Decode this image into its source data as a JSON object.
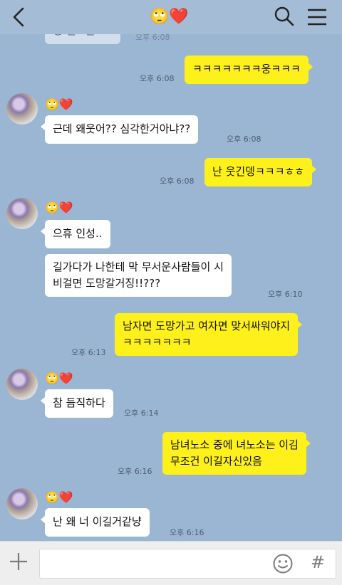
{
  "header": {
    "title": "🙄❤️"
  },
  "messages": [
    {
      "id": 0,
      "from": "other",
      "text": "형 헨드폰???",
      "time": "오후 6:08"
    },
    {
      "id": 1,
      "from": "me",
      "text": "ㅋㅋㅋㅋㅋㅋㅋ웅ㅋㅋㅋ",
      "time": "오후 6:08"
    },
    {
      "id": 2,
      "from": "other",
      "sender": "🙄❤️",
      "text": "근데 왜웃어?? 심각한거아냐??",
      "time": "오후 6:08"
    },
    {
      "id": 3,
      "from": "me",
      "text": "난 웃긴뎅ㅋㅋㅋㅎㅎ",
      "time": "오후 6:08"
    },
    {
      "id": 4,
      "from": "other",
      "sender": "🙄❤️",
      "text": "으휴 인성..",
      "time": ""
    },
    {
      "id": 5,
      "from": "other",
      "lines": [
        "길가다가 나한테 막 무서운사람들이 시",
        "비걸면 도망갈거징!!???"
      ],
      "time": "오후 6:10"
    },
    {
      "id": 6,
      "from": "me",
      "lines": [
        "남자면 도망가고 여자면 맞서싸워야지",
        "ㅋㅋㅋㅋㅋㅋㅋ"
      ],
      "time": "오후 6:13"
    },
    {
      "id": 7,
      "from": "other",
      "sender": "🙄❤️",
      "text": "참 듬직하다",
      "time": "오후 6:14"
    },
    {
      "id": 8,
      "from": "me",
      "lines": [
        "남녀노소 중에 녀노소는 이김",
        "무조건 이길자신있음"
      ],
      "time": "오후 6:16"
    },
    {
      "id": 9,
      "from": "other",
      "sender": "🙄❤️",
      "text": "난 왜 너 이길거같냥",
      "time": "오후 6:16"
    }
  ],
  "input": {
    "placeholder": "",
    "emoji_icon": "smiley-icon",
    "hash_label": "#"
  },
  "colors": {
    "background": "#9bb6d3",
    "my_bubble": "#fef01b",
    "their_bubble": "#ffffff"
  }
}
